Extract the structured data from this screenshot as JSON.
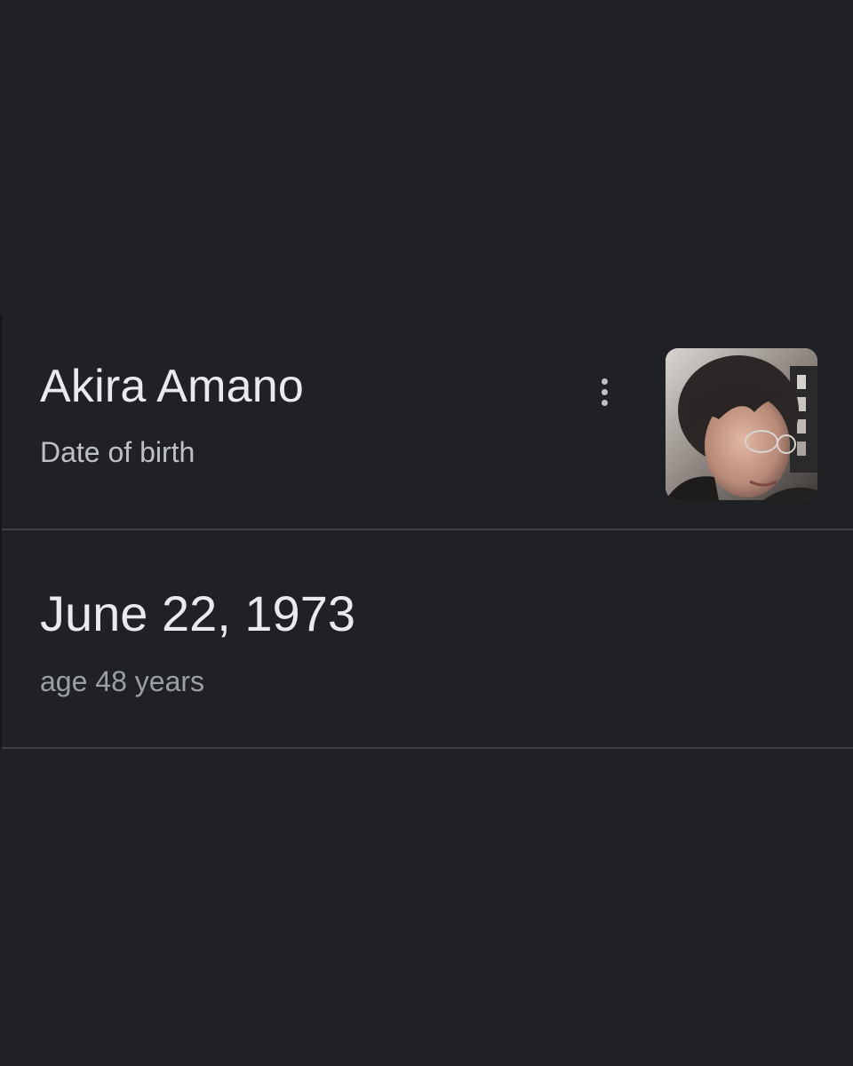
{
  "entity": {
    "name": "Akira Amano",
    "attribute_label": "Date of birth",
    "more_options_icon": "more-vert-icon",
    "thumbnail": "person-photo"
  },
  "answer": {
    "value": "June 22, 1973",
    "detail": "age 48 years"
  },
  "colors": {
    "background": "#202124",
    "divider": "#3c4043",
    "primary_text": "#e8eaed",
    "secondary_text": "#bdc1c6",
    "tertiary_text": "#9aa0a6"
  }
}
